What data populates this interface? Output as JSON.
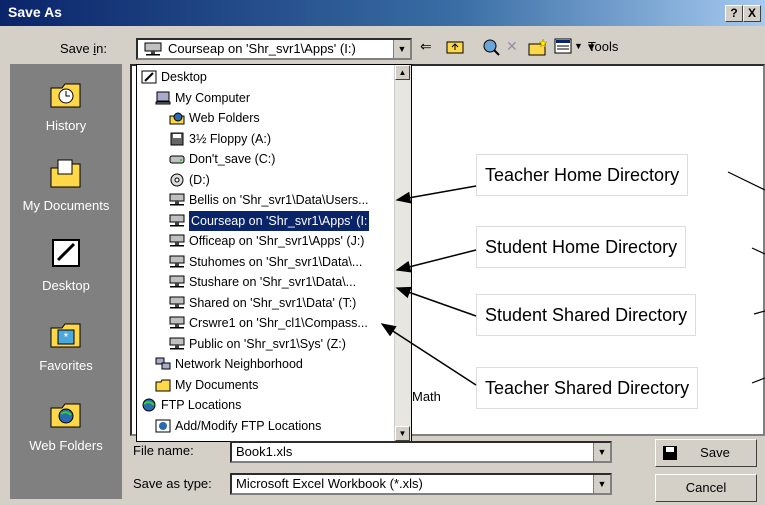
{
  "window": {
    "title": "Save As",
    "help_btn": "?",
    "close_btn": "X"
  },
  "save_in": {
    "label_pre": "Save ",
    "label_accel": "i",
    "label_post": "n:",
    "value": "Courseap on 'Shr_svr1\\Apps' (I:)"
  },
  "toolbar": {
    "tools_label": "Tools"
  },
  "places": [
    {
      "label": "History"
    },
    {
      "label": "My Documents"
    },
    {
      "label": "Desktop"
    },
    {
      "label": "Favorites"
    },
    {
      "label": "Web Folders"
    }
  ],
  "locations": [
    {
      "label": "Desktop",
      "icon": "desktop-icon"
    },
    {
      "label": "My Computer",
      "icon": "computer-icon"
    },
    {
      "label": "Web Folders",
      "icon": "web-folder-icon"
    },
    {
      "label": "3½ Floppy (A:)",
      "icon": "floppy-icon"
    },
    {
      "label": "Don't_save (C:)",
      "icon": "hard-drive-icon"
    },
    {
      "label": "(D:)",
      "icon": "cd-drive-icon"
    },
    {
      "label": "Bellis on 'Shr_svr1\\Data\\Users...",
      "icon": "network-drive-icon"
    },
    {
      "label": "Courseap on 'Shr_svr1\\Apps' (I:",
      "icon": "network-drive-icon",
      "selected": true
    },
    {
      "label": "Officeap on 'Shr_svr1\\Apps' (J:)",
      "icon": "network-drive-icon"
    },
    {
      "label": "Stuhomes on 'Shr_svr1\\Data\\...",
      "icon": "network-drive-icon"
    },
    {
      "label": "Stushare on 'Shr_svr1\\Data\\...",
      "icon": "network-drive-icon"
    },
    {
      "label": "Shared on 'Shr_svr1\\Data' (T:)",
      "icon": "network-drive-icon"
    },
    {
      "label": "Crswre1 on 'Shr_cl1\\Compass...",
      "icon": "network-drive-icon"
    },
    {
      "label": "Public on 'Shr_svr1\\Sys' (Z:)",
      "icon": "network-drive-icon"
    },
    {
      "label": "Network Neighborhood",
      "icon": "network-icon"
    },
    {
      "label": "My Documents",
      "icon": "folder-icon"
    },
    {
      "label": "FTP Locations",
      "icon": "ftp-icon"
    },
    {
      "label": "Add/Modify FTP Locations",
      "icon": "ftp-add-icon"
    }
  ],
  "file_area_fragments": {
    "bar": "l",
    "math": "Math"
  },
  "file_name": {
    "label": "File name:",
    "value": "Book1.xls"
  },
  "save_as_type": {
    "label": "Save as type:",
    "value": "Microsoft Excel Workbook (*.xls)"
  },
  "buttons": {
    "save": "Save",
    "cancel": "Cancel"
  },
  "callouts": [
    {
      "text": "Teacher Home Directory"
    },
    {
      "text": "Student Home Directory"
    },
    {
      "text": "Student Shared Directory"
    },
    {
      "text": "Teacher Shared Directory"
    }
  ],
  "colors": {
    "title_start": "#0a246a",
    "title_end": "#a6caf0",
    "dialog_bg": "#d4d0c8",
    "places_bg": "#808080",
    "selection": "#0a246a"
  }
}
